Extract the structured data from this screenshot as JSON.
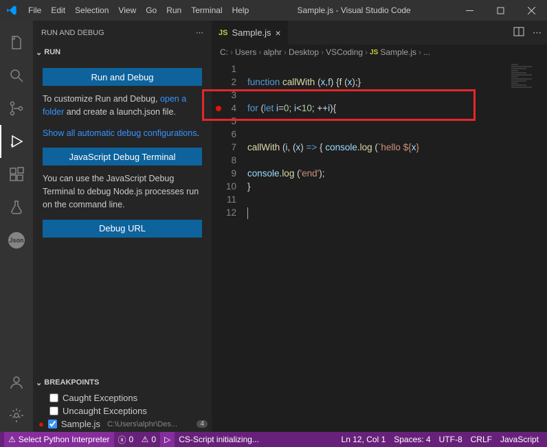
{
  "titlebar": {
    "menus": [
      "File",
      "Edit",
      "Selection",
      "View",
      "Go",
      "Run",
      "Terminal",
      "Help"
    ],
    "title": "Sample.js - Visual Studio Code"
  },
  "sidebar": {
    "header": "RUN AND DEBUG",
    "run_section": "RUN",
    "run_debug_btn": "Run and Debug",
    "customize_pre": "To customize Run and Debug, ",
    "customize_link1": "open a folder",
    "customize_mid": " and create a launch.json file.",
    "show_auto_link": "Show all automatic debug configurations",
    "show_auto_post": ".",
    "jsdt_btn": "JavaScript Debug Terminal",
    "jsdt_desc": "You can use the JavaScript Debug Terminal to debug Node.js processes run on the command line.",
    "debug_url_btn": "Debug URL",
    "breakpoints_header": "BREAKPOINTS",
    "bp_caught": "Caught Exceptions",
    "bp_uncaught": "Uncaught Exceptions",
    "bp_file": "Sample.js",
    "bp_path": "C:\\Users\\alphr\\Des...",
    "bp_line": "4"
  },
  "tabs": {
    "active": "Sample.js"
  },
  "breadcrumb": [
    "C:",
    "Users",
    "alphr",
    "Desktop",
    "VSCoding",
    "Sample.js",
    "..."
  ],
  "code": {
    "lines": [
      {
        "n": 1,
        "seg": []
      },
      {
        "n": 2,
        "seg": [
          {
            "t": "function ",
            "c": "kw"
          },
          {
            "t": "callWith",
            "c": "fn"
          },
          {
            "t": " ("
          },
          {
            "t": "x",
            "c": "var"
          },
          {
            "t": ","
          },
          {
            "t": "f",
            "c": "var"
          },
          {
            "t": ") {"
          },
          {
            "t": "f",
            "c": "fn"
          },
          {
            "t": " ("
          },
          {
            "t": "x",
            "c": "var"
          },
          {
            "t": ");}"
          }
        ]
      },
      {
        "n": 3,
        "seg": []
      },
      {
        "n": 4,
        "seg": [
          {
            "t": "for ",
            "c": "kw"
          },
          {
            "t": "("
          },
          {
            "t": "let ",
            "c": "kw"
          },
          {
            "t": "i",
            "c": "var"
          },
          {
            "t": "="
          },
          {
            "t": "0",
            "c": "num"
          },
          {
            "t": "; "
          },
          {
            "t": "i",
            "c": "var"
          },
          {
            "t": "<"
          },
          {
            "t": "10",
            "c": "num"
          },
          {
            "t": "; ++"
          },
          {
            "t": "i",
            "c": "var"
          },
          {
            "t": "){"
          }
        ],
        "bp": true
      },
      {
        "n": 5,
        "seg": []
      },
      {
        "n": 6,
        "seg": []
      },
      {
        "n": 7,
        "seg": [
          {
            "t": "callWith",
            "c": "fn"
          },
          {
            "t": " ("
          },
          {
            "t": "i",
            "c": "var"
          },
          {
            "t": ", ("
          },
          {
            "t": "x",
            "c": "var"
          },
          {
            "t": ") "
          },
          {
            "t": "=>",
            "c": "kw"
          },
          {
            "t": " { "
          },
          {
            "t": "console",
            "c": "var"
          },
          {
            "t": "."
          },
          {
            "t": "log",
            "c": "fn"
          },
          {
            "t": " ("
          },
          {
            "t": "`hello ${",
            "c": "str"
          },
          {
            "t": "x",
            "c": "var"
          },
          {
            "t": "}",
            "c": "str"
          }
        ]
      },
      {
        "n": 8,
        "seg": []
      },
      {
        "n": 9,
        "seg": [
          {
            "t": "console",
            "c": "var"
          },
          {
            "t": "."
          },
          {
            "t": "log",
            "c": "fn"
          },
          {
            "t": " ("
          },
          {
            "t": "'end'",
            "c": "str"
          },
          {
            "t": ");"
          }
        ]
      },
      {
        "n": 10,
        "seg": [
          {
            "t": "}"
          }
        ]
      },
      {
        "n": 11,
        "seg": []
      },
      {
        "n": 12,
        "seg": [],
        "cursor": true
      }
    ]
  },
  "statusbar": {
    "python": "Select Python Interpreter",
    "errors": "0",
    "warnings": "0",
    "cs": "CS-Script initializing...",
    "pos": "Ln 12, Col 1",
    "spaces": "Spaces: 4",
    "enc": "UTF-8",
    "eol": "CRLF",
    "lang": "JavaScript"
  }
}
